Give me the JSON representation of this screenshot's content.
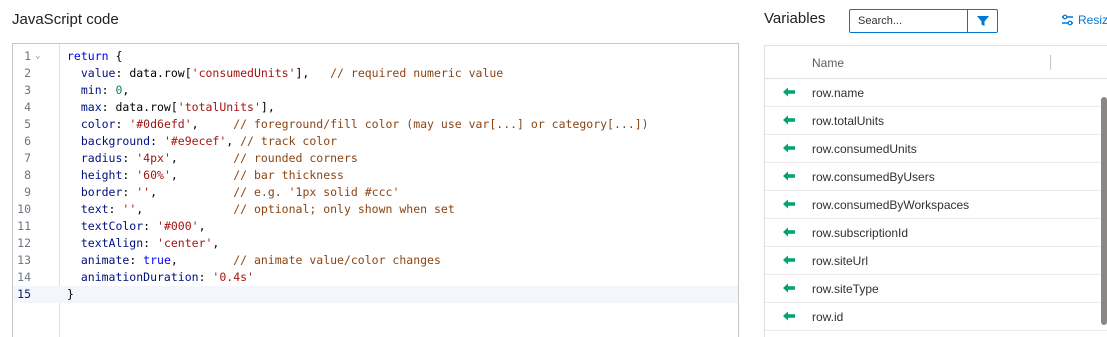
{
  "js_panel": {
    "title": "JavaScript code"
  },
  "editor": {
    "lines": [
      {
        "num": "1",
        "fold": true,
        "tokens": [
          [
            "kw",
            "return"
          ],
          [
            "pl",
            " {"
          ]
        ]
      },
      {
        "num": "2",
        "tokens": [
          [
            "id",
            "  value"
          ],
          [
            "pl",
            ": data.row["
          ],
          [
            "str",
            "'consumedUnits'"
          ],
          [
            "pl",
            "],   "
          ],
          [
            "cm",
            "// required numeric value"
          ]
        ]
      },
      {
        "num": "3",
        "tokens": [
          [
            "id",
            "  min"
          ],
          [
            "pl",
            ": "
          ],
          [
            "num",
            "0"
          ],
          [
            "pl",
            ","
          ]
        ]
      },
      {
        "num": "4",
        "tokens": [
          [
            "id",
            "  max"
          ],
          [
            "pl",
            ": data.row["
          ],
          [
            "str",
            "'totalUnits'"
          ],
          [
            "pl",
            "],"
          ]
        ]
      },
      {
        "num": "5",
        "tokens": [
          [
            "id",
            "  color"
          ],
          [
            "pl",
            ": "
          ],
          [
            "str",
            "'#0d6efd'"
          ],
          [
            "pl",
            ",     "
          ],
          [
            "cm",
            "// foreground/fill color (may use var[...] or category[...])"
          ]
        ]
      },
      {
        "num": "6",
        "tokens": [
          [
            "id",
            "  background"
          ],
          [
            "pl",
            ": "
          ],
          [
            "str",
            "'#e9ecef'"
          ],
          [
            "pl",
            ", "
          ],
          [
            "cm",
            "// track color"
          ]
        ]
      },
      {
        "num": "7",
        "tokens": [
          [
            "id",
            "  radius"
          ],
          [
            "pl",
            ": "
          ],
          [
            "str",
            "'4px'"
          ],
          [
            "pl",
            ",        "
          ],
          [
            "cm",
            "// rounded corners"
          ]
        ]
      },
      {
        "num": "8",
        "tokens": [
          [
            "id",
            "  height"
          ],
          [
            "pl",
            ": "
          ],
          [
            "str",
            "'60%'"
          ],
          [
            "pl",
            ",        "
          ],
          [
            "cm",
            "// bar thickness"
          ]
        ]
      },
      {
        "num": "9",
        "tokens": [
          [
            "id",
            "  border"
          ],
          [
            "pl",
            ": "
          ],
          [
            "str",
            "''"
          ],
          [
            "pl",
            ",           "
          ],
          [
            "cm",
            "// e.g. '1px solid #ccc'"
          ]
        ]
      },
      {
        "num": "10",
        "tokens": [
          [
            "id",
            "  text"
          ],
          [
            "pl",
            ": "
          ],
          [
            "str",
            "''"
          ],
          [
            "pl",
            ",             "
          ],
          [
            "cm",
            "// optional; only shown when set"
          ]
        ]
      },
      {
        "num": "11",
        "tokens": [
          [
            "id",
            "  textColor"
          ],
          [
            "pl",
            ": "
          ],
          [
            "str",
            "'#000'"
          ],
          [
            "pl",
            ","
          ]
        ]
      },
      {
        "num": "12",
        "tokens": [
          [
            "id",
            "  textAlign"
          ],
          [
            "pl",
            ": "
          ],
          [
            "str",
            "'center'"
          ],
          [
            "pl",
            ","
          ]
        ]
      },
      {
        "num": "13",
        "tokens": [
          [
            "id",
            "  animate"
          ],
          [
            "pl",
            ": "
          ],
          [
            "kw",
            "true"
          ],
          [
            "pl",
            ",        "
          ],
          [
            "cm",
            "// animate value/color changes"
          ]
        ]
      },
      {
        "num": "14",
        "tokens": [
          [
            "id",
            "  animationDuration"
          ],
          [
            "pl",
            ": "
          ],
          [
            "str",
            "'0.4s'"
          ]
        ]
      },
      {
        "num": "15",
        "active": true,
        "tokens": [
          [
            "pl",
            "}"
          ]
        ]
      }
    ]
  },
  "vars_panel": {
    "title": "Variables",
    "search": {
      "placeholder": "Search...",
      "value": ""
    },
    "filter_icon": "filter-icon",
    "resize_label": "Resize",
    "column_name": "Name",
    "items": [
      "row.name",
      "row.totalUnits",
      "row.consumedUnits",
      "row.consumedByUsers",
      "row.consumedByWorkspaces",
      "row.subscriptionId",
      "row.siteUrl",
      "row.siteType",
      "row.id"
    ]
  },
  "colors": {
    "accent": "#0078d4",
    "insert_arrow": "#00a36c",
    "active_line": "#f3f6fc"
  }
}
